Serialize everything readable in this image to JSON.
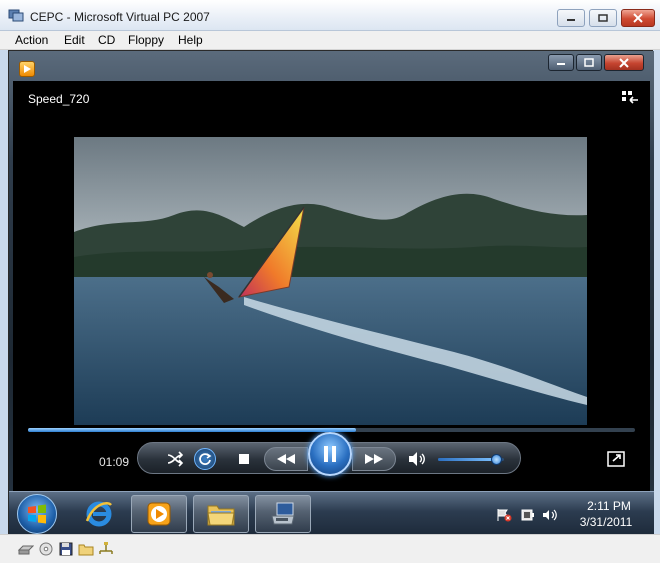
{
  "host_window": {
    "title": "CEPC - Microsoft Virtual PC 2007",
    "menu": [
      "Action",
      "Edit",
      "CD",
      "Floppy",
      "Help"
    ]
  },
  "player": {
    "media_title": "Speed_720",
    "elapsed_time": "01:09",
    "seek_progress": 0.54,
    "volume_level": 0.9,
    "accent_color": "#2d7fd1"
  },
  "taskbar": {
    "items": [
      {
        "name": "start-orb",
        "icon": "windows-logo-icon"
      },
      {
        "name": "internet-explorer",
        "icon": "ie-icon"
      },
      {
        "name": "media-player",
        "icon": "media-player-icon",
        "active": true
      },
      {
        "name": "explorer",
        "icon": "folder-icon"
      },
      {
        "name": "remote",
        "icon": "computer-icon"
      }
    ],
    "tray_icons": [
      "network-error-icon",
      "battery-icon",
      "volume-icon"
    ],
    "clock_time": "2:11 PM",
    "clock_date": "3/31/2011"
  },
  "statusbar_icons": [
    "hard-disk-icon",
    "cd-drive-icon",
    "floppy-icon",
    "shared-folder-icon",
    "network-icon"
  ]
}
